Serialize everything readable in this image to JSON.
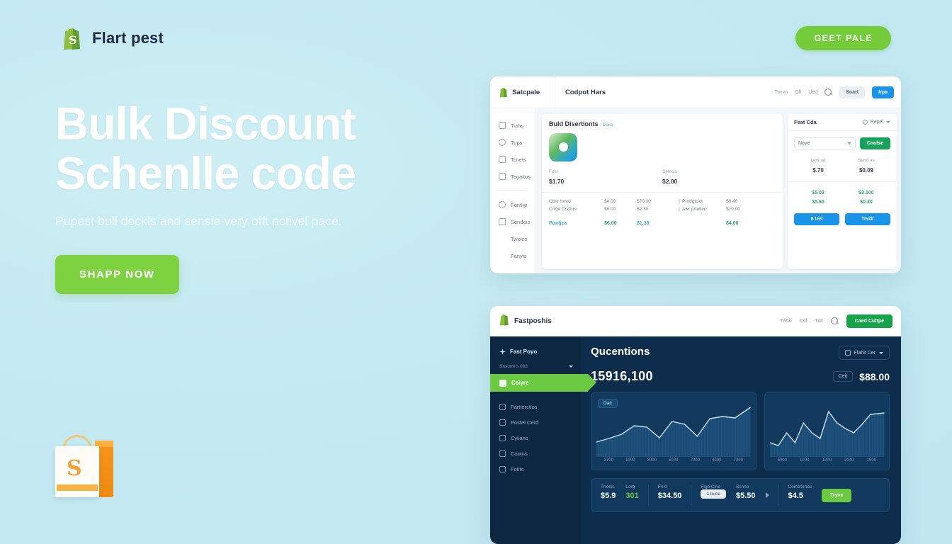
{
  "header": {
    "brand": "Flart pest",
    "brand_icon": "shopify-bag-icon",
    "cta_label": "GEET PALE"
  },
  "hero": {
    "title_line1": "Bulk Discount",
    "title_line2": "Schenlle code",
    "subtitle": "Pupest bull dockls and sensie very offt pctivel pace.",
    "cta_label": "SHAPP NOW"
  },
  "illustration": {
    "name": "shopping-bag-illustration",
    "monogram": "S"
  },
  "card_one": {
    "brand": "Satcpale",
    "page_title": "Codpot Hars",
    "nav": [
      "Twnm",
      "Oft",
      "Ued"
    ],
    "search_icon": "search-icon",
    "btn_secondary": "Soart",
    "btn_primary": "Irpa",
    "sidebar": [
      {
        "label": "Tiahs",
        "icon": "home-icon"
      },
      {
        "label": "Tups",
        "icon": "bag-icon"
      },
      {
        "label": "Tcnets",
        "icon": "tag-icon"
      },
      {
        "label": "Tegaitos",
        "icon": "grid-icon"
      },
      {
        "label": "Fontlijz",
        "icon": "user-icon"
      },
      {
        "label": "Sondeis",
        "icon": "store-icon"
      },
      {
        "label": "Twoles",
        "icon": "blank-icon"
      },
      {
        "label": "Fanyts",
        "icon": "blank-icon"
      }
    ],
    "panel": {
      "title": "Buld Disertionts",
      "link": "Coiur",
      "app_icon": "gradient-app-icon",
      "stats": [
        {
          "label": "Fdla",
          "value": "$1.70"
        },
        {
          "label": "Selecls",
          "value": "$2.00"
        }
      ],
      "rows": [
        {
          "c1": "Cbnr Itrnto",
          "c2": "$4.00",
          "c3": "$70.30",
          "c4": "Prodgtcict",
          "c5": "$8.46"
        },
        {
          "c1": "Crrge Crxtbrs",
          "c2": "$0.00",
          "c3": "$2.30",
          "c4": "Awr prtetlen",
          "c5": "$10.00"
        }
      ],
      "total": {
        "label": "Puntjca",
        "v1": "$6.00",
        "v2": "$1.30",
        "v3": "$4.00"
      }
    },
    "right_panel": {
      "tab": "Feat Cda",
      "dropdown": "Repel",
      "select_value": "Noye",
      "confirm_label": "Cnolse",
      "kv": [
        {
          "label": "Levl ad",
          "value": "$.70"
        },
        {
          "label": "Send as",
          "value": "$0.09"
        }
      ],
      "grid": [
        {
          "left": "$5.03",
          "right": "$3.100"
        },
        {
          "left": "$5.60",
          "right": "$0.20"
        }
      ],
      "buttons": [
        "6 Uel",
        "Trvdr"
      ]
    }
  },
  "card_two": {
    "brand": "Fastposhis",
    "nav": [
      "Twnb",
      "Cdl",
      "Tult"
    ],
    "search_icon": "search-icon",
    "cta_label": "Caed Cuttpe",
    "sidebar": {
      "header": "Fast Poyo",
      "header_icon": "sparkle-icon",
      "sub_label": "Snsorre's 083",
      "active": {
        "label": "Ceiyre",
        "icon": "bag-icon"
      },
      "items": [
        {
          "label": "Fartterctios",
          "icon": "link-icon"
        },
        {
          "label": "Postel Cerd",
          "icon": "card-icon"
        },
        {
          "label": "Cyiians",
          "icon": "cloud-icon"
        },
        {
          "label": "Cootns",
          "icon": "box-icon"
        },
        {
          "label": "Fotits",
          "icon": "list-icon"
        }
      ]
    },
    "main": {
      "title": "Qucentions",
      "pill_label": "Flahit Cer",
      "pill_icon": "bell-icon",
      "big_value": "15916,100",
      "chip_label": "Ceit",
      "amount": "$88.00"
    },
    "stats": [
      {
        "label": "Theeis",
        "value": "$5.9"
      },
      {
        "label": "Lorg",
        "value": "301",
        "accent": "green"
      },
      {
        "label": "F4.0",
        "value": "$34.50"
      },
      {
        "label": "Flgo Clne",
        "pill": "1 buce"
      },
      {
        "label": "Scnne",
        "value": "$5.50"
      },
      {
        "label": "Comtrtorlas",
        "value": "$4.5"
      }
    ],
    "stats_button": "Tryve"
  },
  "chart_data": [
    {
      "type": "area",
      "title": "Datt",
      "position": "left",
      "x": [
        "3700",
        "1000",
        "3000",
        "5000",
        "7000",
        "4000",
        "7300"
      ],
      "values": [
        28,
        38,
        52,
        48,
        30,
        58,
        40,
        36,
        66,
        70,
        68,
        78,
        88
      ],
      "ylim": [
        0,
        100
      ],
      "grid": false,
      "legend": "none",
      "line_color": "#cfe2f1",
      "fill_color": "#1a4f7a"
    },
    {
      "type": "area",
      "title": "",
      "position": "right",
      "x": [
        "5000",
        "1000",
        "1200",
        "2040",
        "1500"
      ],
      "values": [
        26,
        20,
        44,
        30,
        62,
        44,
        34,
        80,
        60,
        52,
        46,
        62,
        76,
        78
      ],
      "ylim": [
        0,
        100
      ],
      "grid": false,
      "legend": "none",
      "line_color": "#cfe2f1",
      "fill_color": "#1a4f7a"
    }
  ],
  "colors": {
    "page_bg": "#c4e9f2",
    "brand_green": "#74cc3a",
    "cta_green": "#7ed242",
    "dark_panel": "#0e2c4b",
    "accent_blue": "#1a94e8",
    "success_green": "#2fa36b"
  }
}
